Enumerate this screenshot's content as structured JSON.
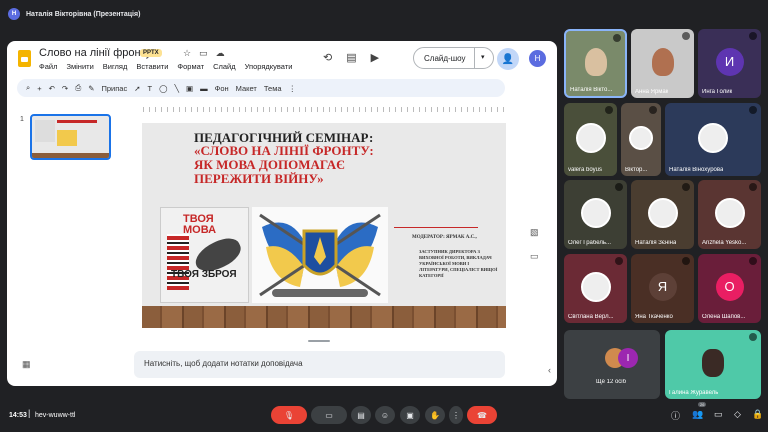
{
  "window": {
    "avatar_letter": "Н",
    "title": "Наталія Вікторівна (Презентація)"
  },
  "slides_app": {
    "doc_title": "Слово на лінії фронту",
    "format_badge": "PPTX",
    "menu": [
      "Файл",
      "Змінити",
      "Вигляд",
      "Вставити",
      "Формат",
      "Слайд",
      "Упорядкувати"
    ],
    "slideshow_label": "Слайд-шоу",
    "user_letter": "Н",
    "toolbar": {
      "zoom_label": "Припас",
      "background": "Фон",
      "layout": "Макет",
      "theme": "Тема"
    },
    "slide_number": "1",
    "notes_placeholder": "Натисніть, щоб додати нотатки доповідача"
  },
  "slide": {
    "title_line1": "ПЕДАГОГІЧНИЙ СЕМІНАР:",
    "title_line2": "«СЛОВО НА ЛІНІЇ ФРОНТУ:",
    "title_line3": "ЯК МОВА ДОПОМАГАЄ",
    "title_line4": "ПЕРЕЖИТИ ВІЙНУ»",
    "poster_top": "ТВОЯ МОВА",
    "poster_bottom": "ТВОЯ ЗБРОЯ",
    "moderator": "МОДЕРАТОР: ЯРМАК А.С.,",
    "position": "ЗАСТУПНИК ДИРЕКТОРА З ВИХОВНОЇ РОБОТИ, ВИКЛАДАЧ УКРАЇНСЬКОЇ МОВИ І ЛІТЕРАТУРИ, СПЕЦІАЛІСТ ВИЩОЇ КАТЕГОРІЇ"
  },
  "participants": [
    {
      "name": "Наталія Вікто...",
      "tile": "video"
    },
    {
      "name": "Анна Ярмак",
      "tile": "video"
    },
    {
      "name": "Инга Голик",
      "tile": "letter",
      "letter": "И",
      "color": "#5e35b1"
    },
    {
      "name": "valera boyus",
      "tile": "photo"
    },
    {
      "name": "Віктор...",
      "tile": "photo"
    },
    {
      "name": "Наталія Віноxурова",
      "tile": "photo"
    },
    {
      "name": "Олег Грабель...",
      "tile": "photo"
    },
    {
      "name": "Наталія Зєніна",
      "tile": "photo"
    },
    {
      "name": "Anzhela Yesko...",
      "tile": "photo"
    },
    {
      "name": "Світлана Верл...",
      "tile": "photo"
    },
    {
      "name": "Яна Ткаченко",
      "tile": "letter",
      "letter": "Я",
      "color": "#5d4037"
    },
    {
      "name": "Олена Шапов...",
      "tile": "letter",
      "letter": "О",
      "color": "#e91e63"
    },
    {
      "name": "Ще 12 осіб",
      "tile": "more",
      "letter": "І"
    },
    {
      "name": "Галина Журавель",
      "tile": "video"
    }
  ],
  "meeting": {
    "time": "14:53",
    "code": "hev-wuww-ttl",
    "participant_count": "26"
  },
  "colors": {
    "accent": "#1a73e8",
    "end_call": "#ea4335",
    "meet_bg": "#202124"
  }
}
